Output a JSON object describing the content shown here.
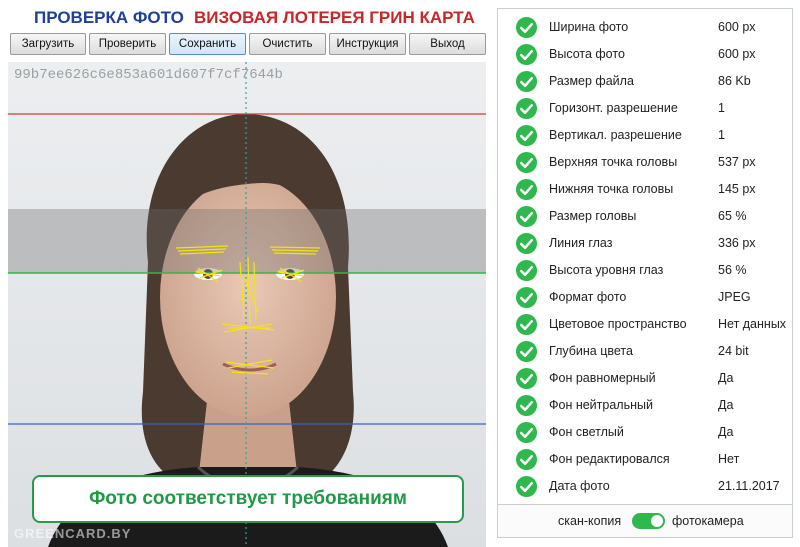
{
  "header": {
    "title_left": "ПРОВЕРКА ФОТО",
    "title_right": "ВИЗОВАЯ ЛОТЕРЕЯ ГРИН КАРТА"
  },
  "colors": {
    "left_title": "#1f3f9a",
    "right_title": "#c8262a",
    "ok_green": "#2fb84d"
  },
  "toolbar": [
    {
      "label": "Загрузить"
    },
    {
      "label": "Проверить"
    },
    {
      "label": "Сохранить"
    },
    {
      "label": "Очистить"
    },
    {
      "label": "Инструкция"
    },
    {
      "label": "Выход"
    }
  ],
  "photo": {
    "hash": "99b7ee626c6e853a601d607f7cf7644b",
    "watermark": "GREENCARD.BY",
    "result": "Фото соответствует требованиям"
  },
  "checks": [
    {
      "label": "Ширина фото",
      "value": "600 px"
    },
    {
      "label": "Высота фото",
      "value": "600 px"
    },
    {
      "label": "Размер файла",
      "value": "86 Kb"
    },
    {
      "label": "Горизонт. разрешение",
      "value": "1"
    },
    {
      "label": "Вертикал. разрешение",
      "value": "1"
    },
    {
      "label": "Верхняя точка головы",
      "value": "537 px"
    },
    {
      "label": "Нижняя точка головы",
      "value": "145 px"
    },
    {
      "label": "Размер головы",
      "value": "65 %"
    },
    {
      "label": "Линия глаз",
      "value": "336 px"
    },
    {
      "label": "Высота уровня глаз",
      "value": "56 %"
    },
    {
      "label": "Формат фото",
      "value": "JPEG"
    },
    {
      "label": "Цветовое пространство",
      "value": "Нет данных"
    },
    {
      "label": "Глубина цвета",
      "value": "24 bit"
    },
    {
      "label": "Фон равномерный",
      "value": "Да"
    },
    {
      "label": "Фон нейтральный",
      "value": "Да"
    },
    {
      "label": "Фон светлый",
      "value": "Да"
    },
    {
      "label": "Фон редактировался",
      "value": "Нет"
    },
    {
      "label": "Дата фото",
      "value": "21.11.2017"
    }
  ],
  "source_toggle": {
    "left_label": "скан-копия",
    "right_label": "фотокамера",
    "selected": "фотокамера"
  }
}
